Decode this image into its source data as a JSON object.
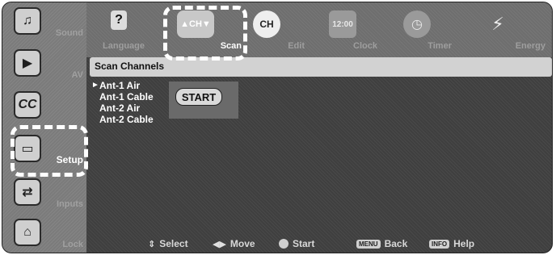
{
  "sidebar": {
    "items": [
      {
        "label": "Sound",
        "icon": "sound-icon",
        "glyph": "♫"
      },
      {
        "label": "AV",
        "icon": "av-icon",
        "glyph": "▶"
      },
      {
        "label": "",
        "icon": "cc-icon",
        "glyph": "CC"
      },
      {
        "label": "Setup",
        "icon": "setup-icon",
        "glyph": "▭",
        "active": true
      },
      {
        "label": "Inputs",
        "icon": "inputs-icon",
        "glyph": "⇄"
      },
      {
        "label": "Lock",
        "icon": "lock-icon",
        "glyph": "🔒"
      }
    ]
  },
  "tabs": {
    "items": [
      {
        "label": "Language",
        "icon": "question-icon",
        "glyph": "?"
      },
      {
        "label": "Scan",
        "icon": "scan-icon",
        "glyph": "▲CH▼",
        "active": true
      },
      {
        "label": "Edit",
        "icon": "ch-icon",
        "glyph": "CH"
      },
      {
        "label": "Clock",
        "icon": "clock-icon",
        "glyph": "12:00"
      },
      {
        "label": "Timer",
        "icon": "timer-icon",
        "glyph": "◷"
      },
      {
        "label": "Energy",
        "icon": "energy-icon",
        "glyph": "⚡"
      }
    ]
  },
  "title": "Scan Channels",
  "channels": {
    "items": [
      "Ant-1 Air",
      "Ant-1 Cable",
      "Ant-2 Air",
      "Ant-2 Cable"
    ],
    "selected_index": 0
  },
  "start_button": "START",
  "help": {
    "select": "Select",
    "move": "Move",
    "start": "Start",
    "back": "Back",
    "help": "Help",
    "menu_key": "MENU",
    "info_key": "INFO"
  }
}
